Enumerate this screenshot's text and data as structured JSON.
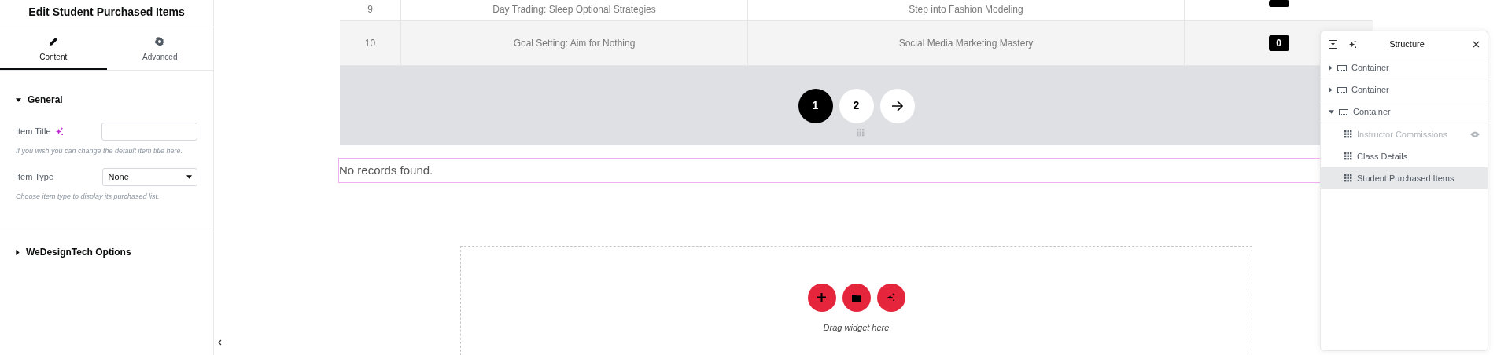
{
  "panel": {
    "title": "Edit Student Purchased Items",
    "tabs": [
      {
        "label": "Content",
        "selected": true
      },
      {
        "label": "Advanced",
        "selected": false
      }
    ],
    "sections": [
      {
        "title": "General",
        "expanded": true,
        "fields": [
          {
            "kind": "text",
            "label": "Item Title",
            "ai": true,
            "help": "If you wish you can change the default item title here."
          },
          {
            "kind": "select",
            "label": "Item Type",
            "value": "None",
            "help": "Choose item type to display its purchased list."
          }
        ]
      },
      {
        "title": "WeDesignTech Options",
        "expanded": false
      }
    ]
  },
  "table": {
    "rows": [
      {
        "cells": [
          "9",
          "Day Trading: Sleep Optional Strategies",
          "Step into Fashion Modeling"
        ]
      },
      {
        "cells": [
          "10",
          "Goal Setting: Aim for Nothing",
          "Social Media Marketing Mastery"
        ],
        "count": "0"
      }
    ]
  },
  "pagination": [
    {
      "label": "1",
      "selected": true
    },
    {
      "label": "2",
      "selected": false
    }
  ],
  "notice": "No records found.",
  "dropzone": {
    "hint": "Drag widget here"
  },
  "structure": {
    "title": "Structure",
    "items": [
      {
        "label": "Container",
        "expanded": false,
        "selected": false
      },
      {
        "label": "Container",
        "expanded": false,
        "selected": false
      },
      {
        "label": "Container",
        "expanded": true,
        "selected": false,
        "children": [
          {
            "label": "Instructor Commissions",
            "hidden": true,
            "selected": false
          },
          {
            "label": "Class Details",
            "hidden": false,
            "selected": false
          },
          {
            "label": "Student Purchased Items",
            "hidden": false,
            "selected": true
          }
        ]
      }
    ]
  }
}
